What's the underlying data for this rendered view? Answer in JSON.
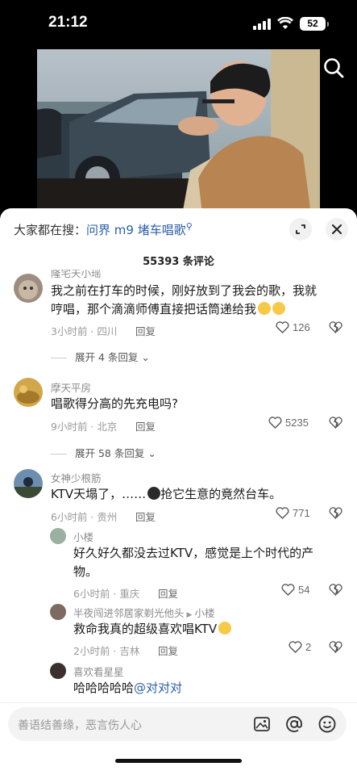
{
  "status_bar": {
    "time": "21:12",
    "battery": "52"
  },
  "video": {
    "search_icon": "search-icon"
  },
  "sheet": {
    "search_prefix": "大家都在搜：",
    "search_query": "问界 m9 堵车唱歌",
    "comment_count": "55393 条评论",
    "comments": [
      {
        "user": "隆宅天小瑶",
        "text": "我之前在打车的时候，刚好放到了我会的歌，我就哼唱，那个滴滴师傅直接把话筒递给我",
        "time": "3小时前 · 四川",
        "reply": "回复",
        "likes": "126",
        "expand": "展开 4 条回复"
      },
      {
        "user": "摩天平房",
        "text": "唱歌得分高的先充电吗?",
        "time": "9小时前 · 北京",
        "reply": "回复",
        "likes": "5235",
        "expand": "展开 58 条回复"
      },
      {
        "user": "女神少根筋",
        "text_a": "KTV天塌了，……",
        "text_b": "抢它生意的竟然台车。",
        "time": "6小时前 · 贵州",
        "reply": "回复",
        "likes": "771"
      }
    ],
    "replies": [
      {
        "user": "小楼",
        "text": "好久好久都没去过KTV，感觉是上个时代的产物。",
        "time": "6小时前 · 重庆",
        "reply": "回复",
        "likes": "54"
      },
      {
        "user": "半夜闯进邻居家剃光他头",
        "reply_to": "小楼",
        "text": "救命我真的超级喜欢唱KTV",
        "time": "2小时前 · 吉林",
        "reply": "回复",
        "likes": "2"
      },
      {
        "user": "喜欢看星星",
        "text": "哈哈哈哈哈",
        "mention": "@对对对"
      }
    ],
    "input_placeholder": "善语结善缘，恶言伤人心"
  }
}
